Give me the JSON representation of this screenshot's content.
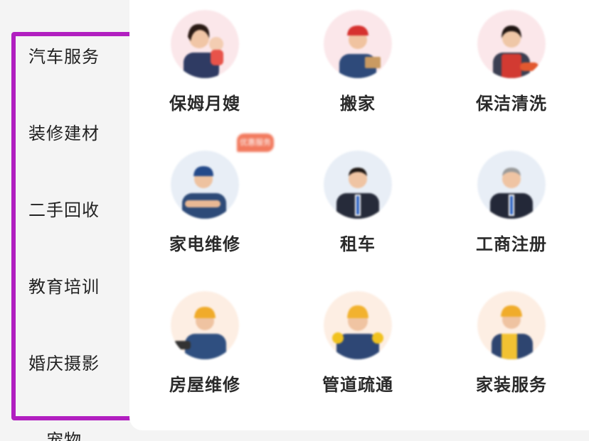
{
  "sidebar": {
    "items": [
      {
        "label": "汽车服务"
      },
      {
        "label": "装修建材"
      },
      {
        "label": "二手回收"
      },
      {
        "label": "教育培训"
      },
      {
        "label": "婚庆摄影"
      },
      {
        "label": "宠物"
      }
    ]
  },
  "services": [
    {
      "label": "保姆月嫂",
      "icon": "nanny-avatar-icon"
    },
    {
      "label": "搬家",
      "icon": "mover-avatar-icon"
    },
    {
      "label": "保洁清洗",
      "icon": "cleaner-avatar-icon"
    },
    {
      "label": "家电维修",
      "icon": "appliance-repair-avatar-icon"
    },
    {
      "label": "租车",
      "icon": "car-rental-avatar-icon"
    },
    {
      "label": "工商注册",
      "icon": "business-registration-avatar-icon"
    },
    {
      "label": "房屋维修",
      "icon": "house-repair-avatar-icon"
    },
    {
      "label": "管道疏通",
      "icon": "pipe-dredging-avatar-icon"
    },
    {
      "label": "家装服务",
      "icon": "home-decoration-avatar-icon"
    }
  ],
  "badge": {
    "text": "优惠服务"
  },
  "colors": {
    "highlight": "#b11fc0",
    "badge": "#f27a5e",
    "avatar_bg": "#fbe7ea"
  }
}
